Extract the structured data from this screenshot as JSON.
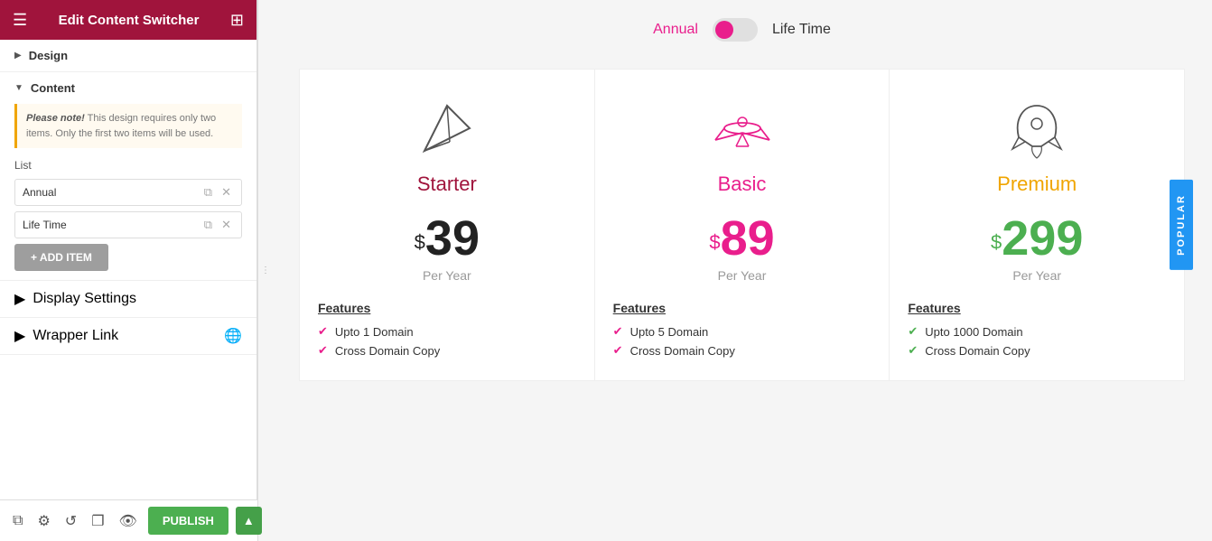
{
  "header": {
    "title": "Edit Content Switcher"
  },
  "sidebar": {
    "design_label": "Design",
    "content_label": "Content",
    "note_bold": "Please note!",
    "note_text": " This design requires only two items. Only the first two items will be used.",
    "list_label": "List",
    "list_items": [
      {
        "value": "Annual"
      },
      {
        "value": "Life Time"
      }
    ],
    "add_item_label": "+ ADD ITEM",
    "display_settings_label": "Display Settings",
    "wrapper_link_label": "Wrapper Link",
    "publish_label": "PUBLISH"
  },
  "main": {
    "toggle_annual": "Annual",
    "toggle_lifetime": "Life Time",
    "cards": [
      {
        "title": "Starter",
        "title_class": "starter",
        "icon_type": "paper-plane",
        "price_symbol": "$",
        "price": "39",
        "period": "Per Year",
        "features_label": "Features",
        "features": [
          "Upto 1 Domain",
          "Cross Domain Copy"
        ]
      },
      {
        "title": "Basic",
        "title_class": "basic",
        "icon_type": "airplane",
        "price_symbol": "$",
        "price": "89",
        "period": "Per Year",
        "features_label": "Features",
        "features": [
          "Upto 5 Domain",
          "Cross Domain Copy"
        ]
      },
      {
        "title": "Premium",
        "title_class": "premium",
        "icon_type": "rocket",
        "price_symbol": "$",
        "price": "299",
        "period": "Per Year",
        "features_label": "Features",
        "features": [
          "Upto 1000 Domain",
          "Cross Domain Copy"
        ],
        "popular": "POPULAR"
      }
    ]
  }
}
